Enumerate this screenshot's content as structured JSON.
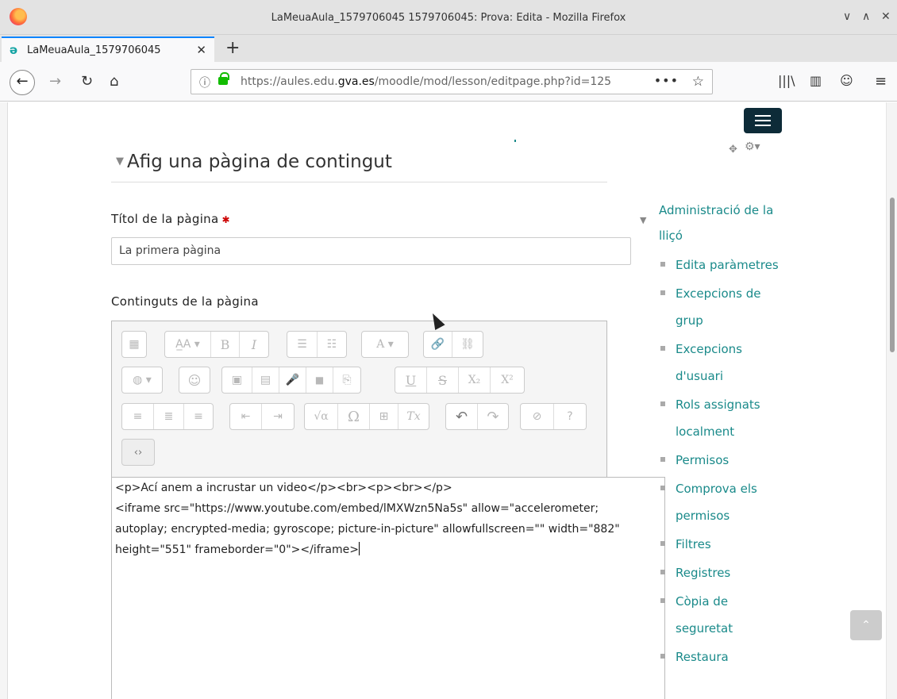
{
  "window": {
    "title": "LaMeuaAula_1579706045 1579706045: Prova: Edita - Mozilla Firefox",
    "controls": [
      "∨",
      "∧",
      "✕"
    ]
  },
  "tab": {
    "label": "LaMeuaAula_1579706045",
    "close": "✕",
    "new_tab": "+"
  },
  "urlbar": {
    "info": "ⓘ",
    "url_prefix": "https://aules.edu.",
    "url_domain": "gva.es",
    "url_path": "/moodle/mod/lesson/editpage.php?id=125",
    "more": "•••",
    "star": "☆"
  },
  "nav": {
    "back": "←",
    "forward": "→",
    "reload": "↻",
    "home": "⌂",
    "library": "|||\\",
    "reader": "▥",
    "account": "☺",
    "menu": "≡"
  },
  "page": {
    "section_title": "Afig una pàgina de contingut",
    "title_label": "Títol de la pàgina",
    "title_value": "La primera pàgina",
    "contents_label": "Continguts de la pàgina",
    "editor_lines": [
      "<p>Ací anem a incrustar un video</p><br><p><br></p>",
      "<iframe src=\"https://www.youtube.com/embed/lMXWzn5Na5s\" allow=\"accelerometer;",
      "autoplay; encrypted-media; gyroscope; picture-in-picture\" allowfullscreen=\"\" width=\"882\"",
      "height=\"551\" frameborder=\"0\"></iframe>"
    ]
  },
  "toolbar": {
    "row1": [
      [
        "▦"
      ],
      [
        "A̲A ▾",
        "B",
        "I"
      ],
      [
        "☰",
        "☷"
      ],
      [
        "A ▾"
      ],
      [
        "🔗",
        "⛓"
      ]
    ],
    "row2": [
      [
        "◍ ▾"
      ],
      [
        "☺"
      ],
      [
        "▣",
        "▤",
        "🎤",
        "■",
        "⎘"
      ],
      [
        "U",
        "S",
        "X₂",
        "X²"
      ]
    ],
    "row3": [
      [
        "≡",
        "≣",
        "≡"
      ],
      [
        "⇤",
        "⇥"
      ],
      [
        "√α",
        "Ω",
        "⊞",
        "Tx"
      ],
      [
        "↶",
        "↷"
      ],
      [
        "⊘",
        "?"
      ]
    ],
    "row4": [
      [
        "‹›"
      ]
    ]
  },
  "sidebar": {
    "heading": "Administració de la lliçó",
    "items": [
      "Edita paràmetres",
      "Excepcions de grup",
      "Excepcions d'usuari",
      "Rols assignats localment",
      "Permisos",
      "Comprova els permisos",
      "Filtres",
      "Registres",
      "Còpia de seguretat",
      "Restaura"
    ]
  },
  "colors": {
    "accent": "#1a8a8a",
    "navbar": "#0d2b38",
    "required": "#cc0000"
  }
}
